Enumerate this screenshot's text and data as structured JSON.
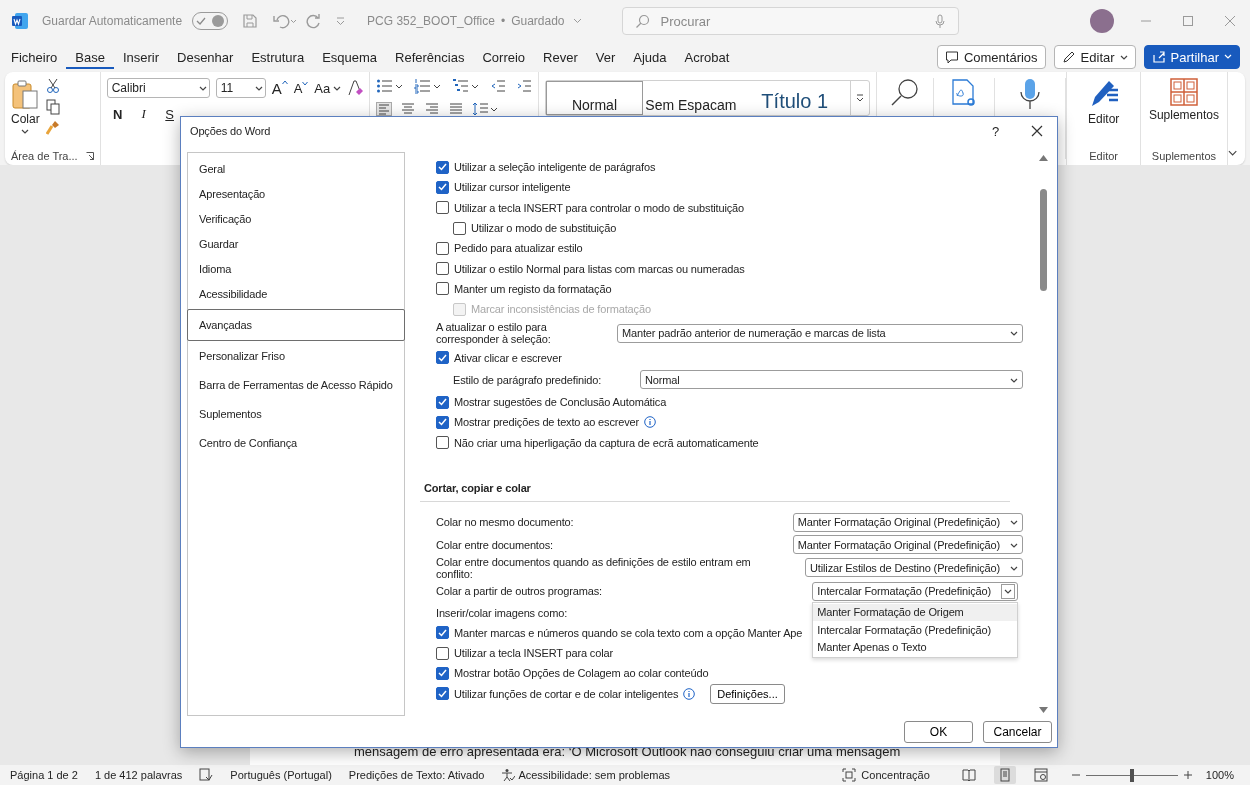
{
  "title_bar": {
    "autosave_label": "Guardar Automaticamente",
    "autosave_on": true,
    "document_title": "PCG 352_BOOT_Office",
    "separator": "•",
    "save_state": "Guardado",
    "search_placeholder": "Procurar"
  },
  "menu_tabs": [
    {
      "label": "Ficheiro",
      "selected": false
    },
    {
      "label": "Base",
      "selected": true
    },
    {
      "label": "Inserir",
      "selected": false
    },
    {
      "label": "Desenhar",
      "selected": false
    },
    {
      "label": "Estrutura",
      "selected": false
    },
    {
      "label": "Esquema",
      "selected": false
    },
    {
      "label": "Referências",
      "selected": false
    },
    {
      "label": "Correio",
      "selected": false
    },
    {
      "label": "Rever",
      "selected": false
    },
    {
      "label": "Ver",
      "selected": false
    },
    {
      "label": "Ajuda",
      "selected": false
    },
    {
      "label": "Acrobat",
      "selected": false
    }
  ],
  "header_buttons": [
    {
      "kind": "comments",
      "label": "Comentários"
    },
    {
      "kind": "edit",
      "label": "Editar"
    },
    {
      "kind": "share",
      "label": "Partilhar"
    }
  ],
  "ribbon": {
    "paste_label": "Colar",
    "clipboard_group": "Área de Tra...",
    "font_name": "Calibri",
    "font_size": "11",
    "grow_font": "A",
    "shrink_font": "A",
    "change_case": "Aa",
    "format_buttons": [
      "N",
      "I",
      "S"
    ],
    "styles": [
      {
        "label": "Normal",
        "selected": true
      },
      {
        "label": "Sem Espacam",
        "selected": false
      },
      {
        "label": "Título 1",
        "selected": false
      }
    ],
    "editor_label": "Editor",
    "editor_group": "Editor",
    "addins_label": "Suplementos",
    "addins_group": "Suplementos"
  },
  "dialog": {
    "title": "Opções do Word",
    "help": "?",
    "nav": [
      {
        "label": "Geral",
        "selected": false
      },
      {
        "label": "Apresentação",
        "selected": false
      },
      {
        "label": "Verificação",
        "selected": false
      },
      {
        "label": "Guardar",
        "selected": false
      },
      {
        "label": "Idioma",
        "selected": false
      },
      {
        "label": "Acessibilidade",
        "selected": false
      },
      {
        "label": "Avançadas",
        "selected": true
      },
      {
        "label": "Personalizar Friso",
        "selected": false
      },
      {
        "label": "Barra de Ferramentas de Acesso Rápido",
        "selected": false
      },
      {
        "label": "Suplementos",
        "selected": false
      },
      {
        "label": "Centro de Confiança",
        "selected": false
      }
    ],
    "sections": [
      {
        "rows": [
          {
            "kind": "checkbox",
            "label": "Utilizar a seleção inteligente de parágrafos",
            "checked": true
          },
          {
            "kind": "checkbox",
            "label": "Utilizar cursor inteligente",
            "checked": true
          },
          {
            "kind": "checkbox",
            "label": "Utilizar a tecla INSERT para controlar o modo de substituição",
            "checked": false,
            "children": [
              {
                "kind": "checkbox",
                "label": "Utilizar o modo de substituição",
                "checked": false,
                "disabled": false
              }
            ]
          },
          {
            "kind": "checkbox",
            "label": "Pedido para atualizar estilo",
            "checked": false
          },
          {
            "kind": "checkbox",
            "label": "Utilizar o estilo Normal para listas com marcas ou numeradas",
            "checked": false
          },
          {
            "kind": "checkbox",
            "label": "Manter um registo da formatação",
            "checked": false,
            "children": [
              {
                "kind": "checkbox",
                "label": "Marcar inconsistências de formatação",
                "checked": false,
                "disabled": true
              }
            ]
          },
          {
            "kind": "select",
            "label": "A atualizar o estilo para corresponder à seleção:",
            "value": "Manter padrão anterior de numeração e marcas de lista"
          },
          {
            "kind": "checkbox",
            "label": "Ativar clicar e escrever",
            "checked": true,
            "children": [
              {
                "kind": "select",
                "label": "Estilo de parágrafo predefinido:",
                "value": "Normal"
              }
            ]
          },
          {
            "kind": "checkbox",
            "label": "Mostrar sugestões de Conclusão Automática",
            "checked": true
          },
          {
            "kind": "checkbox",
            "label": "Mostrar predições de texto ao escrever",
            "checked": true,
            "info": true
          },
          {
            "kind": "checkbox",
            "label": "Não criar uma hiperligação da captura de ecrã automaticamente",
            "checked": false
          }
        ]
      },
      {
        "heading": "Cortar, copiar e colar",
        "rows": [
          {
            "kind": "select",
            "label": "Colar no mesmo documento:",
            "value": "Manter Formatação Original (Predefinição)"
          },
          {
            "kind": "select",
            "label": "Colar entre documentos:",
            "value": "Manter Formatação Original (Predefinição)"
          },
          {
            "kind": "select",
            "label": "Colar entre documentos quando as definições de estilo entram em conflito:",
            "value": "Utilizar Estilos de Destino (Predefinição)"
          },
          {
            "kind": "select",
            "label": "Colar a partir de outros programas:",
            "value": "Intercalar Formatação (Predefinição)",
            "open": true,
            "options": [
              {
                "label": "Manter Formatação de Origem",
                "highlighted": true
              },
              {
                "label": "Intercalar Formatação (Predefinição)",
                "highlighted": false
              },
              {
                "label": "Manter Apenas o Texto",
                "highlighted": false
              }
            ]
          },
          {
            "kind": "label",
            "label": "Inserir/colar imagens como:"
          },
          {
            "kind": "checkbox",
            "label": "Manter marcas e números quando se cola texto com a opção Manter Ape",
            "checked": true
          },
          {
            "kind": "checkbox",
            "label": "Utilizar a tecla INSERT para colar",
            "checked": false
          },
          {
            "kind": "checkbox",
            "label": "Mostrar botão Opções de Colagem ao colar conteúdo",
            "checked": true
          },
          {
            "kind": "checkbox",
            "label": "Utilizar funções de cortar e de colar inteligentes",
            "checked": true,
            "info": true,
            "button": "Definições..."
          }
        ]
      }
    ],
    "buttons": [
      "OK",
      "Cancelar"
    ]
  },
  "document": {
    "visible_line": "mensagem de erro apresentada era: ‘O Microsoft Outlook não conseguiu criar uma mensagem"
  },
  "status_bar": {
    "page": "Página 1 de 2",
    "words": "1 de 412 palavras",
    "language": "Português (Portugal)",
    "predictions": "Predições de Texto: Ativado",
    "accessibility": "Acessibilidade: sem problemas",
    "focus": "Concentração",
    "view_modes": [
      {
        "kind": "read",
        "selected": false
      },
      {
        "kind": "print",
        "selected": true
      },
      {
        "kind": "web",
        "selected": false
      }
    ],
    "zoom": {
      "level": 0.5,
      "reading": "100%"
    }
  }
}
